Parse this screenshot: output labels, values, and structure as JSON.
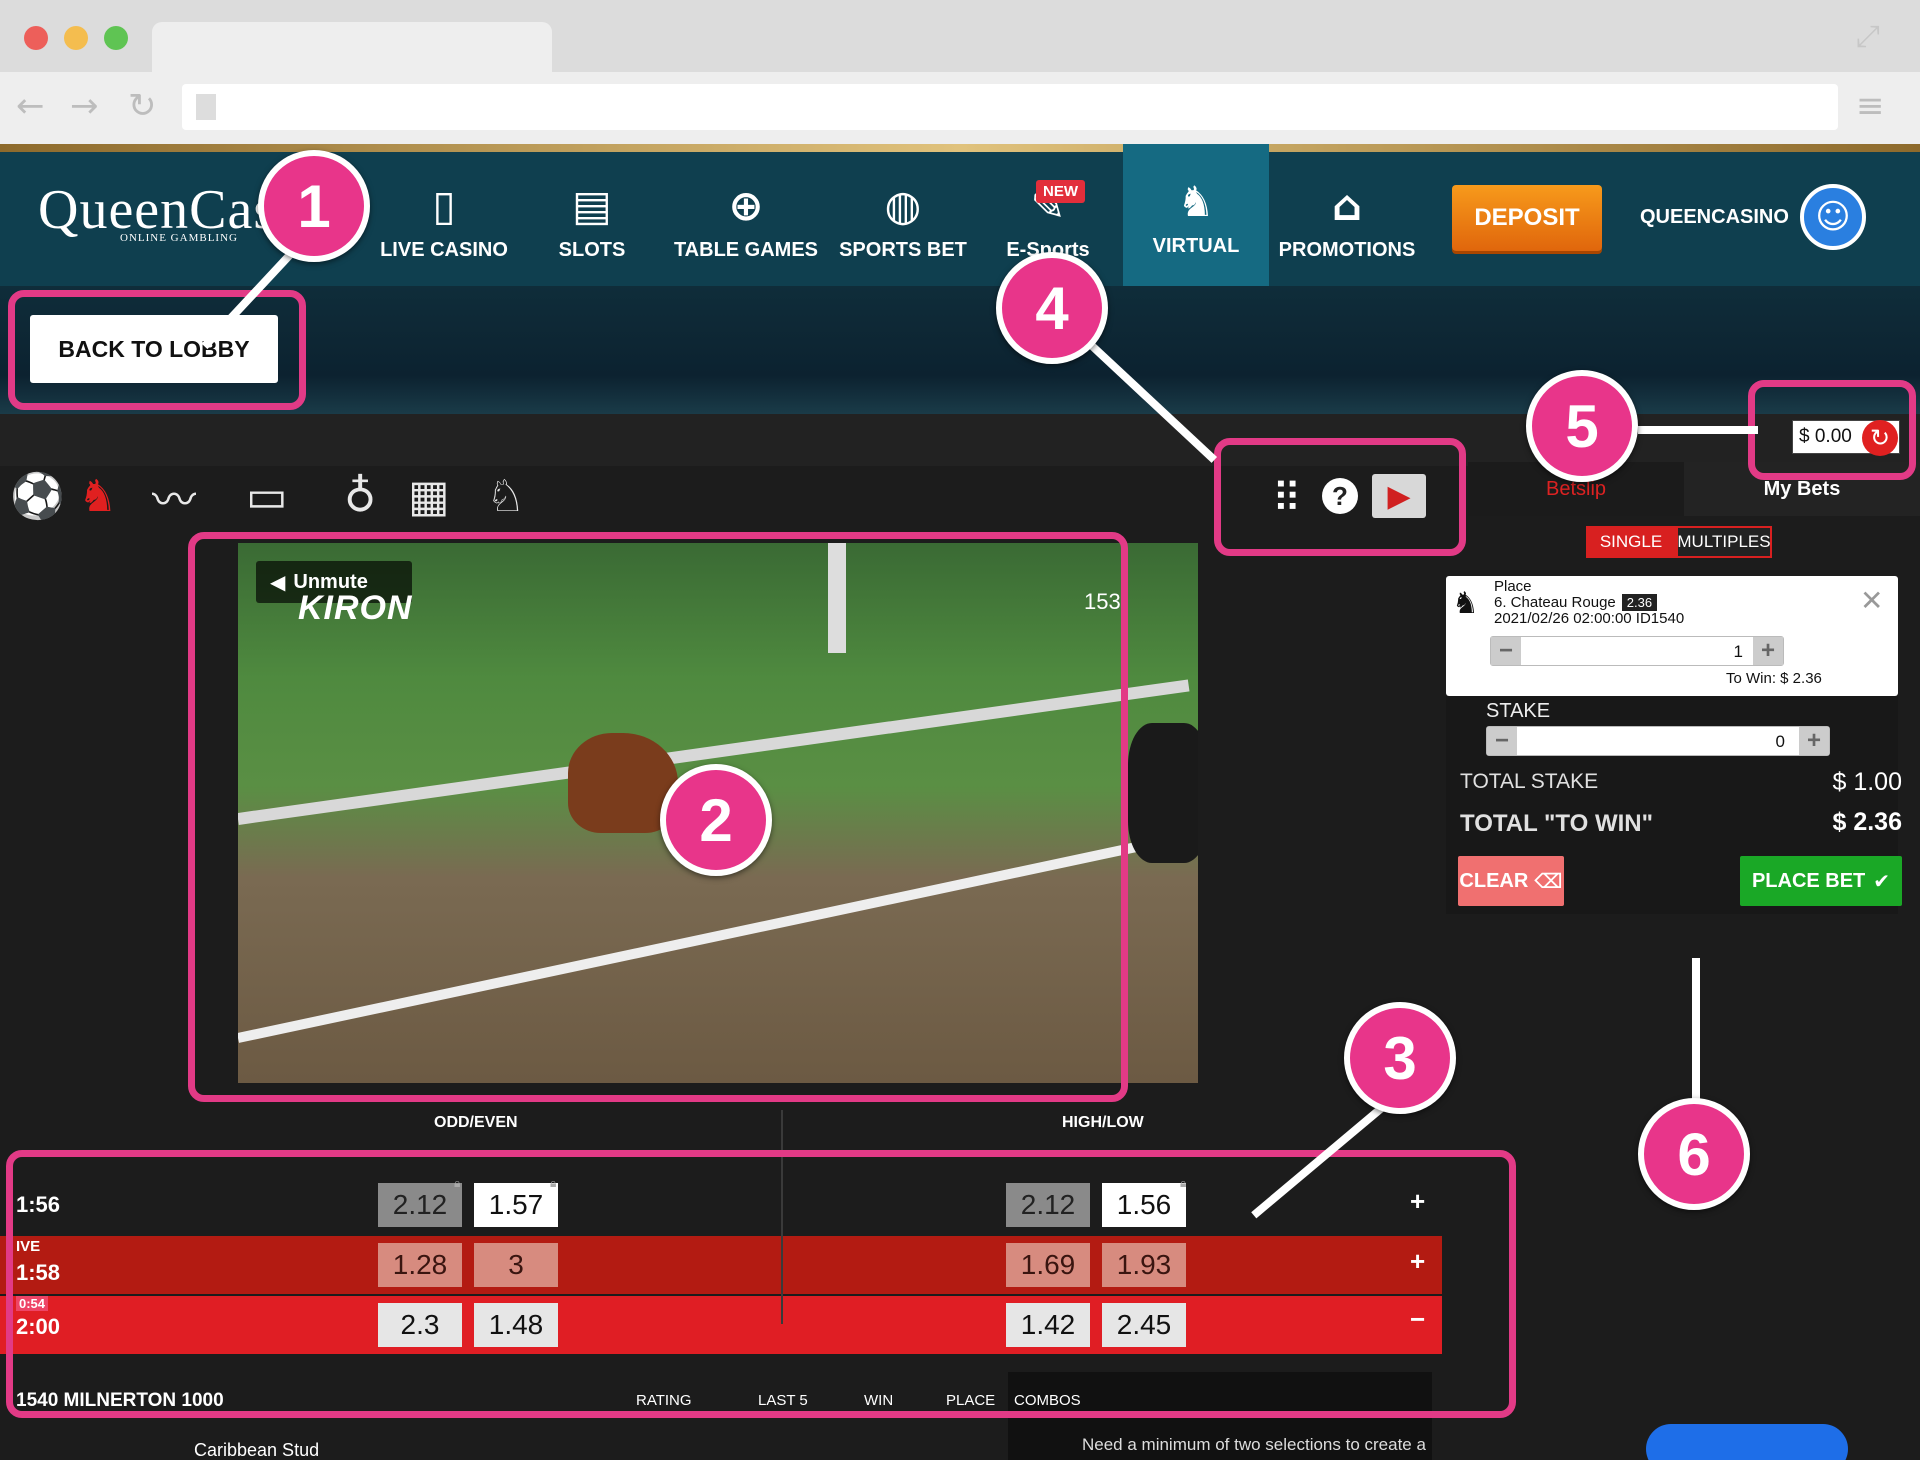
{
  "site": {
    "logo": "QueenCasino",
    "logo_sub": "ONLINE GAMBLING",
    "nav": [
      {
        "label": "LIVE CASINO",
        "icon": "card-icon"
      },
      {
        "label": "SLOTS",
        "icon": "slots-icon"
      },
      {
        "label": "TABLE GAMES",
        "icon": "roulette-icon"
      },
      {
        "label": "SPORTS BET",
        "icon": "ball-icon"
      },
      {
        "label": "E-Sports",
        "icon": "controller-icon",
        "badge": "NEW"
      },
      {
        "label": "VIRTUAL",
        "icon": "horse-icon"
      },
      {
        "label": "PROMOTIONS",
        "icon": "gift-icon"
      }
    ],
    "deposit_label": "DEPOSIT",
    "username": "QUEENCASINO",
    "back_label": "BACK TO LOBBY"
  },
  "video": {
    "unmute_label": "Unmute",
    "provider": "KIRON",
    "time": "153"
  },
  "betslip": {
    "balance": "$ 0.00",
    "tab_betslip": "Betslip",
    "tab_mybets": "My Bets",
    "seg_single": "SINGLE",
    "seg_multiples": "MULTIPLES",
    "bet": {
      "type": "Place",
      "selection": "6. Chateau Rouge",
      "odds": "2.36",
      "event": "2021/02/26 02:00:00 ID1540",
      "amount": "1",
      "to_win": "To Win: $ 2.36"
    },
    "stake_label": "STAKE",
    "stake_value": "0",
    "total_stake_label": "TOTAL STAKE",
    "total_stake": "$ 1.00",
    "total_win_label": "TOTAL \"TO WIN\"",
    "total_win": "$ 2.36",
    "clear_label": "CLEAR",
    "place_label": "PLACE BET"
  },
  "odds_table": {
    "headers": {
      "odd_even": "ODD/EVEN",
      "high_low": "HIGH/LOW"
    },
    "rows": [
      {
        "time": "1:56",
        "live": "",
        "countdown": "",
        "odds": [
          "2.12",
          "1.57",
          "2.12",
          "1.56"
        ],
        "toggle": "+"
      },
      {
        "time": "1:58",
        "live": "IVE",
        "countdown": "",
        "odds": [
          "1.28",
          "3",
          "1.69",
          "1.93"
        ],
        "toggle": "+"
      },
      {
        "time": "2:00",
        "live": "",
        "countdown": "0:54",
        "odds": [
          "2.3",
          "1.48",
          "1.42",
          "2.45"
        ],
        "toggle": "−"
      }
    ],
    "race_title": "1540 MILNERTON 1000",
    "columns": [
      "RATING",
      "LAST 5",
      "WIN",
      "PLACE",
      "COMBOS"
    ],
    "horse": "Caribbean Stud",
    "combo_msg": "Need a minimum of two selections to create a"
  },
  "annotations": [
    "1",
    "2",
    "3",
    "4",
    "5",
    "6"
  ],
  "colors": {
    "highlight": "#e23a86",
    "header": "#0f3f4f",
    "virtual": "#156a82",
    "red": "#e01e24"
  }
}
